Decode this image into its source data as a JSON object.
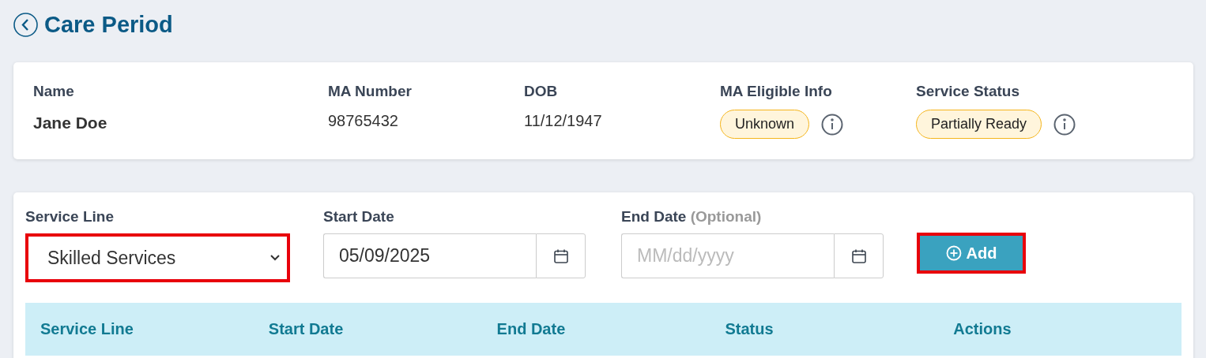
{
  "header": {
    "title": "Care Period"
  },
  "patient": {
    "fields": [
      {
        "label": "Name",
        "value": "Jane Doe",
        "kind": "text"
      },
      {
        "label": "MA Number",
        "value": "98765432",
        "kind": "text"
      },
      {
        "label": "DOB",
        "value": "11/12/1947",
        "kind": "text"
      },
      {
        "label": "MA Eligible Info",
        "value": "Unknown",
        "kind": "badge"
      },
      {
        "label": "Service Status",
        "value": "Partially Ready",
        "kind": "badge"
      }
    ]
  },
  "form": {
    "service_line": {
      "label": "Service Line",
      "value": "Skilled Services",
      "highlighted": true
    },
    "start_date": {
      "label": "Start Date",
      "value": "05/09/2025"
    },
    "end_date": {
      "label": "End Date",
      "hint": "(Optional)",
      "placeholder": "MM/dd/yyyy"
    },
    "add_button": {
      "label": "Add",
      "highlighted": true
    }
  },
  "table": {
    "columns": [
      "Service Line",
      "Start Date",
      "End Date",
      "Status",
      "Actions"
    ]
  }
}
